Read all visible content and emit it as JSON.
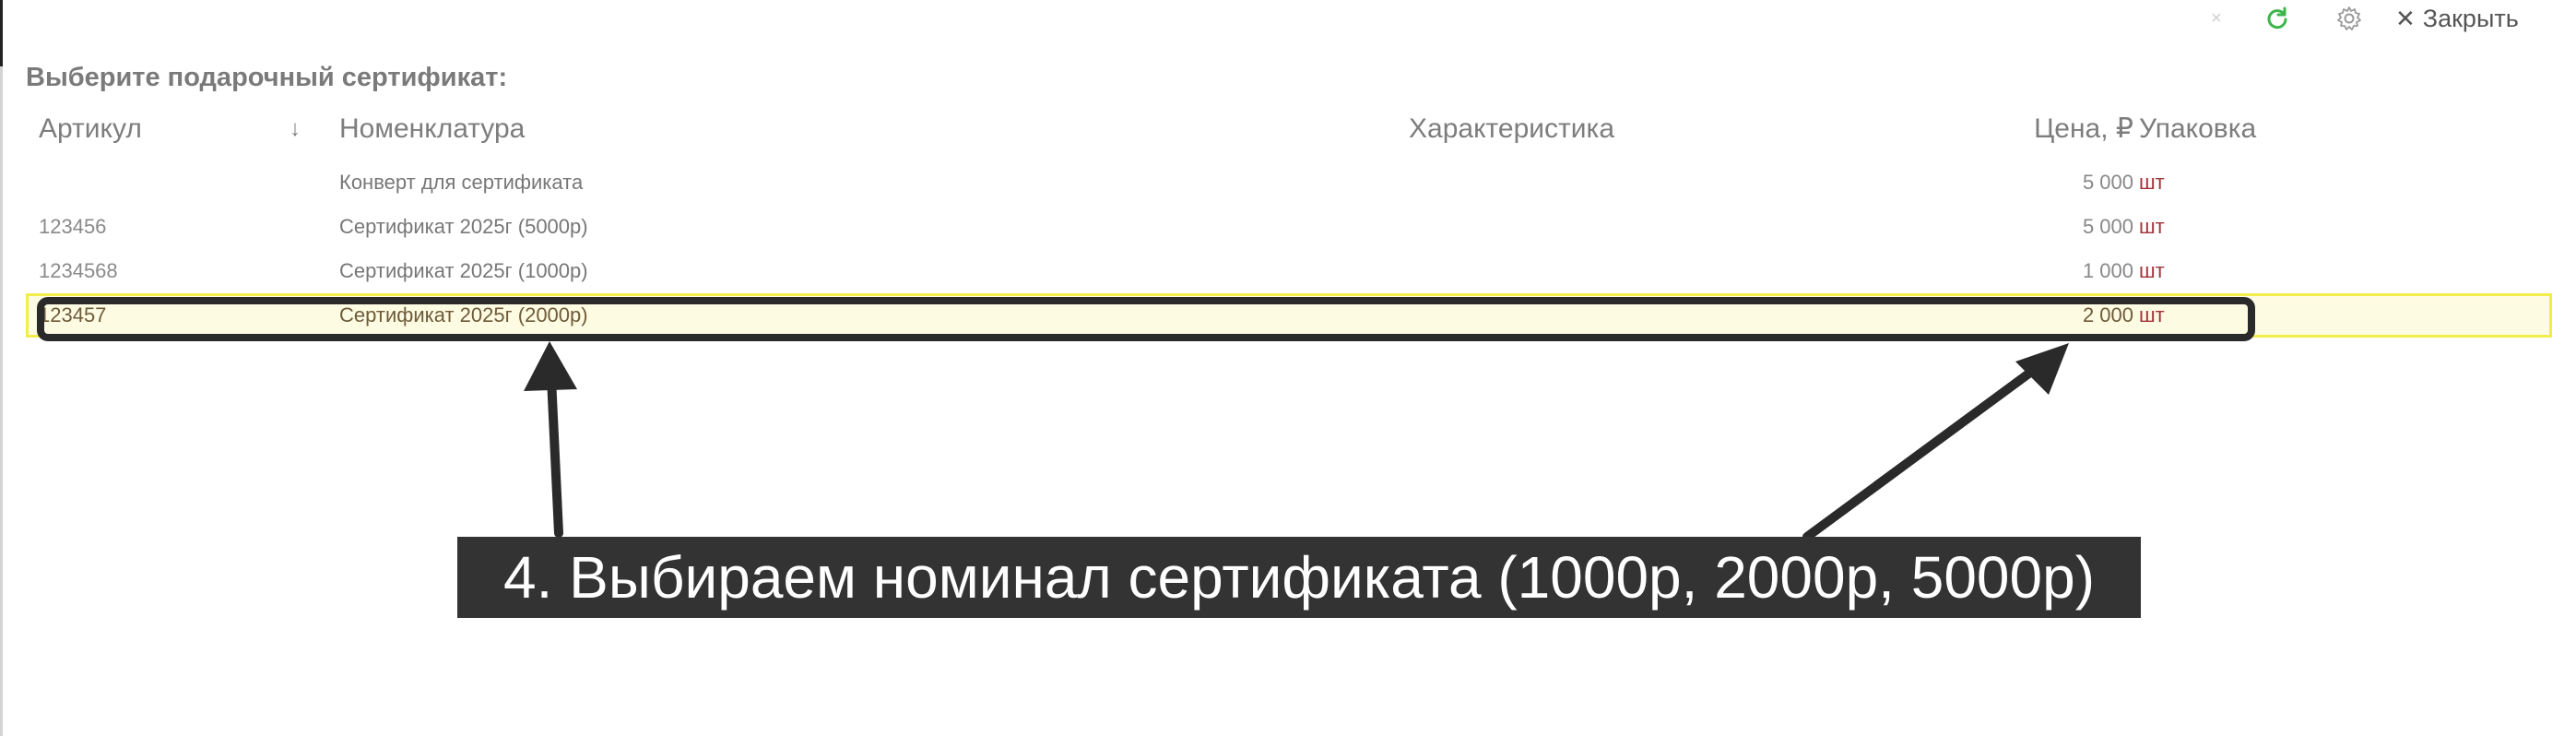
{
  "toolbar": {
    "small_close_icon": "close-icon",
    "refresh_icon": "refresh-icon",
    "settings_icon": "gear-icon",
    "close_label": "Закрыть"
  },
  "form": {
    "title": "Выберите подарочный сертификат:"
  },
  "table": {
    "columns": {
      "article": "Артикул",
      "sort_indicator": "↓",
      "nomenclature": "Номенклатура",
      "characteristic": "Характеристика",
      "price": "Цена, ₽",
      "packaging": "Упаковка"
    },
    "rows": [
      {
        "article": "",
        "nomenclature": "Конверт для сертификата",
        "characteristic": "",
        "price": "5 000",
        "packaging": "шт",
        "selected": false
      },
      {
        "article": "123456",
        "nomenclature": "Сертификат 2025г (5000р)",
        "characteristic": "",
        "price": "5 000",
        "packaging": "шт",
        "selected": false
      },
      {
        "article": "1234568",
        "nomenclature": "Сертификат 2025г (1000р)",
        "characteristic": "",
        "price": "1 000",
        "packaging": "шт",
        "selected": false
      },
      {
        "article": "123457",
        "nomenclature": "Сертификат 2025г (2000р)",
        "characteristic": "",
        "price": "2 000",
        "packaging": "шт",
        "selected": true
      }
    ]
  },
  "annotation": {
    "text": "4. Выбираем номинал сертификата (1000р, 2000р, 5000р)"
  },
  "colors": {
    "selected_row_border": "#f1ee4a",
    "selected_row_fill": "#fefbe3",
    "packaging_text": "#a2343a",
    "callout_bg": "#333333",
    "refresh_icon": "#3bb54a"
  }
}
